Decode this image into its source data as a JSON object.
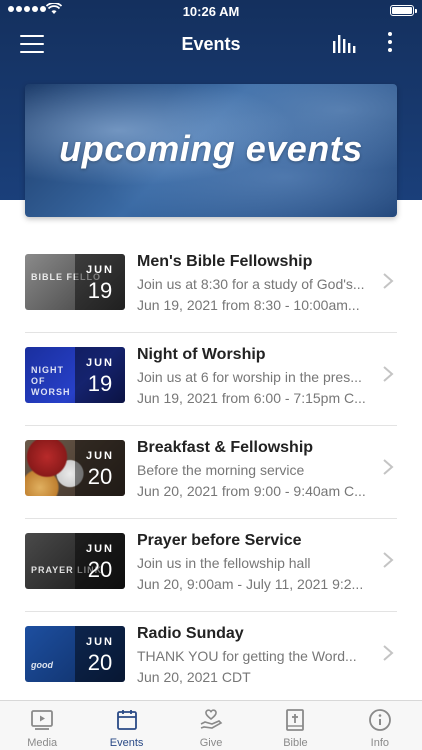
{
  "status_bar": {
    "time": "10:26 AM"
  },
  "nav": {
    "title": "Events",
    "menu_icon": "hamburger-menu-icon",
    "chart_icon": "bar-chart-icon",
    "more_icon": "more-vertical-icon"
  },
  "banner": {
    "text": "upcoming events"
  },
  "events": [
    {
      "title": "Men's Bible Fellowship",
      "description": "Join us at 8:30 for a study of God's...",
      "date_line": "Jun 19, 2021 from 8:30 - 10:00am...",
      "month": "JUN",
      "day": "19",
      "thumb_text": "BIBLE FELLO"
    },
    {
      "title": "Night of Worship",
      "description": "Join us at 6 for worship in the pres...",
      "date_line": "Jun 19, 2021 from 6:00 - 7:15pm C...",
      "month": "JUN",
      "day": "19",
      "thumb_text": "NIGHT OF WORSH"
    },
    {
      "title": "Breakfast & Fellowship",
      "description": "Before the morning service",
      "date_line": "Jun 20, 2021 from 9:00 - 9:40am C...",
      "month": "JUN",
      "day": "20",
      "thumb_text": ""
    },
    {
      "title": "Prayer before Service",
      "description": "Join us in the fellowship hall",
      "date_line": "Jun 20, 9:00am - July 11, 2021 9:2...",
      "month": "JUN",
      "day": "20",
      "thumb_text": "PRAYER LINK"
    },
    {
      "title": "Radio Sunday",
      "description": "THANK YOU for getting the Word...",
      "date_line": "Jun 20, 2021 CDT",
      "month": "JUN",
      "day": "20",
      "thumb_text": "good"
    }
  ],
  "tabs": [
    {
      "label": "Media",
      "icon": "media-play-icon",
      "active": false
    },
    {
      "label": "Events",
      "icon": "calendar-icon",
      "active": true
    },
    {
      "label": "Give",
      "icon": "give-heart-hand-icon",
      "active": false
    },
    {
      "label": "Bible",
      "icon": "bible-cross-icon",
      "active": false
    },
    {
      "label": "Info",
      "icon": "info-icon",
      "active": false
    }
  ],
  "colors": {
    "header": "#1a3f7a",
    "active_tab": "#2a4a86",
    "inactive_tab": "#8a8a8a"
  }
}
